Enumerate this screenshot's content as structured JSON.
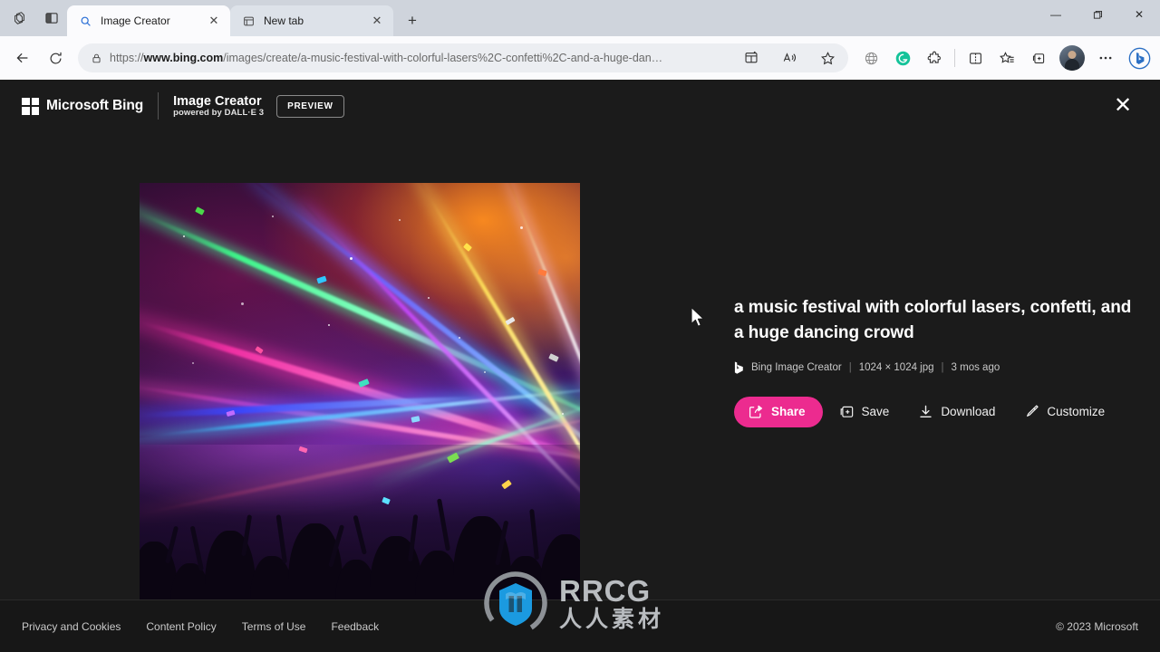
{
  "window": {
    "controls": {
      "minimize": "—",
      "maximize": "❐",
      "close": "✕"
    },
    "tab_actions_icon": "tab-actions-icon",
    "split_screen_icon": "browser-essentials-icon"
  },
  "tabs": [
    {
      "title": "Image Creator",
      "favicon": "search-icon",
      "active": true,
      "close_label": "✕"
    },
    {
      "title": "New tab",
      "favicon": "new-tab-page-icon",
      "active": false,
      "close_label": "✕"
    }
  ],
  "newtab_button_label": "+",
  "toolbar": {
    "back_icon": "back-arrow-icon",
    "refresh_icon": "refresh-icon",
    "lock_icon": "lock-icon",
    "url_scheme": "https://",
    "url_domain": "www.bing.com",
    "url_path": "/images/create/a-music-festival-with-colorful-lasers%2C-confetti%2C-and-a-huge-dan…",
    "url_full": "https://www.bing.com/images/create/a-music-festival-with-colorful-lasers%2C-confetti%2C-and-a-huge-dan…",
    "split_icon": "split-screen-pane-icon",
    "read_aloud_icon": "read-aloud-icon",
    "favorite_icon": "add-to-favorites-star-icon",
    "globe_icon": "globe-icon",
    "grammarly_icon": "grammarly-extension-icon",
    "extensions_icon": "extensions-puzzle-icon",
    "split_screen_icon": "split-screen-icon",
    "collections_icon": "favorites-list-icon",
    "browser_essentials_icon": "collections-icon",
    "profile_icon": "profile-avatar-icon",
    "settings_icon": "settings-and-more-ellipsis-icon",
    "copilot_icon": "bing-copilot-icon"
  },
  "header": {
    "microsoft_label": "Microsoft Bing",
    "product_title": "Image Creator",
    "product_subtitle": "powered by DALL·E 3",
    "preview_badge": "PREVIEW",
    "close_label": "✕",
    "ms_logo_icon": "microsoft-logo-icon"
  },
  "image": {
    "alt": "a music festival with colorful lasers, confetti, and a huge dancing crowd",
    "watermark_icon": "bing-watermark-icon"
  },
  "details": {
    "prompt": "a music festival with colorful lasers, confetti, and a huge dancing crowd",
    "source_icon": "bing-b-icon",
    "source": "Bing Image Creator",
    "separator": "|",
    "dimensions": "1024 × 1024 jpg",
    "age": "3 mos ago"
  },
  "actions": [
    {
      "label": "Share",
      "icon": "share-icon",
      "primary": true
    },
    {
      "label": "Save",
      "icon": "save-icon",
      "primary": false
    },
    {
      "label": "Download",
      "icon": "download-icon",
      "primary": false
    },
    {
      "label": "Customize",
      "icon": "customize-edit-icon",
      "primary": false
    }
  ],
  "footer": {
    "links": [
      "Privacy and Cookies",
      "Content Policy",
      "Terms of Use",
      "Feedback"
    ],
    "copyright": "© 2023 Microsoft"
  },
  "watermark": {
    "english": "RRCG",
    "chinese": "人人素材",
    "logo_icon": "rrcg-logo-icon"
  },
  "colors": {
    "accent_pink": "#ec2b8f",
    "page_background": "#1b1b1b",
    "footer_background": "#171717",
    "chrome_background": "#cfd4dc",
    "toolbar_background": "#fbfbfd"
  }
}
